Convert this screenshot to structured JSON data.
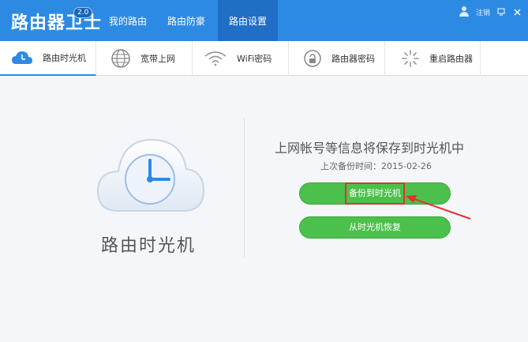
{
  "app": {
    "title": "路由器卫士",
    "version": "2.0"
  },
  "nav": {
    "tabs": [
      "我的路由",
      "路由防豪",
      "路由设置"
    ]
  },
  "top_tools": {
    "logout_label": "注销"
  },
  "subnav": {
    "tabs": [
      "路由时光机",
      "宽带上网",
      "WiFi密码",
      "路由器密码",
      "重启路由器"
    ]
  },
  "main": {
    "feature_title": "路由时光机",
    "info_title": "上网帐号等信息将保存到时光机中",
    "last_backup_label": "上次备份时间：",
    "last_backup_date": "2015-02-26",
    "backup_button": "备份到时光机",
    "restore_button": "从时光机恢复"
  },
  "colors": {
    "primary": "#2d8ae3",
    "active_tab": "#1f6fc6",
    "button_green": "#4cc04c",
    "highlight_red": "#e0332f"
  },
  "icons": [
    "clock-icon",
    "globe-icon",
    "wifi-icon",
    "lock-icon",
    "power-icon",
    "cloud-clock-icon",
    "user-icon",
    "minimize-icon",
    "close-icon"
  ]
}
